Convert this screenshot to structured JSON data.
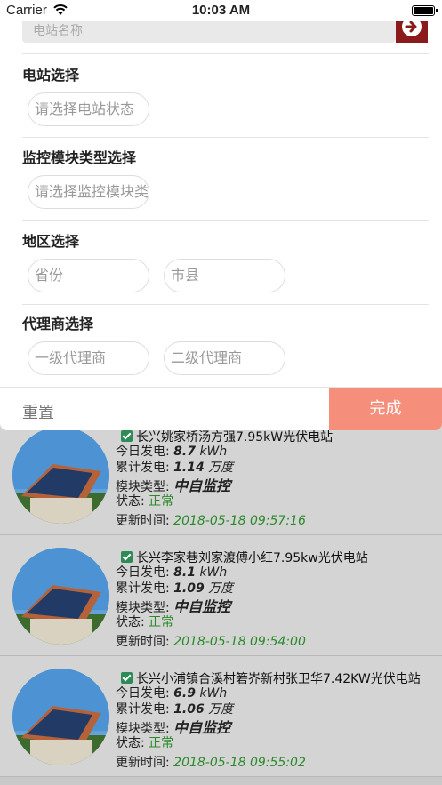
{
  "status_bar": {
    "carrier": "Carrier",
    "time": "10:03 AM"
  },
  "search": {
    "placeholder": "电站名称"
  },
  "sections": {
    "station": {
      "title": "电站选择",
      "placeholder": "请选择电站状态"
    },
    "module": {
      "title": "监控模块类型选择",
      "placeholder": "请选择监控模块类"
    },
    "region": {
      "title": "地区选择",
      "province": "省份",
      "city": "市县"
    },
    "agent": {
      "title": "代理商选择",
      "level1": "一级代理商",
      "level2": "二级代理商"
    }
  },
  "actions": {
    "reset": "重置",
    "done": "完成",
    "done_color": "#f58e7b"
  },
  "labels": {
    "today": "今日发电:",
    "total": "累计发电:",
    "module_type": "模块类型:",
    "status": "状态:",
    "updated": "更新时间:"
  },
  "stations": [
    {
      "name": "长兴姚家桥汤方强7.95kW光伏电站",
      "today_value": "8.7",
      "today_unit": "kWh",
      "total_value": "1.14",
      "total_unit": "万度",
      "module": "中自监控",
      "status": "正常",
      "updated": "2018-05-18 09:57:16"
    },
    {
      "name": "长兴李家巷刘家渡傅小红7.95kw光伏电站",
      "today_value": "8.1",
      "today_unit": "kWh",
      "total_value": "1.09",
      "total_unit": "万度",
      "module": "中自监控",
      "status": "正常",
      "updated": "2018-05-18 09:54:00"
    },
    {
      "name": "长兴小浦镇合溪村箬岕新村张卫华7.42KW光伏电站",
      "today_value": "6.9",
      "today_unit": "kWh",
      "total_value": "1.06",
      "total_unit": "万度",
      "module": "中自监控",
      "status": "正常",
      "updated": "2018-05-18 09:55:02"
    }
  ],
  "colors": {
    "go_button": "#8b1a1d",
    "status_ok": "#2a8a2a"
  }
}
